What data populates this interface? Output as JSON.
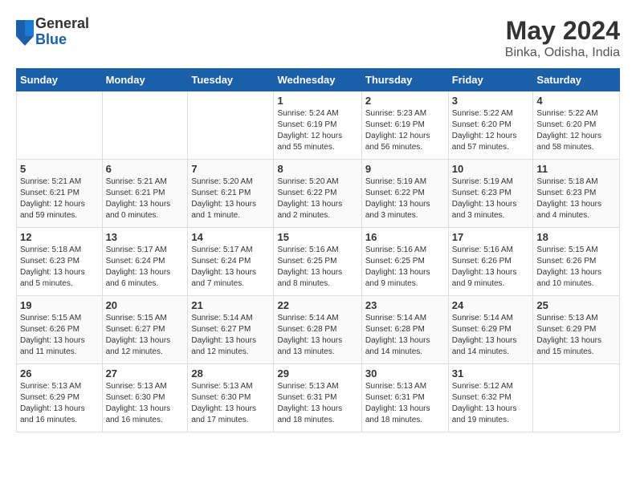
{
  "header": {
    "logo_general": "General",
    "logo_blue": "Blue",
    "title": "May 2024",
    "subtitle": "Binka, Odisha, India"
  },
  "days_of_week": [
    "Sunday",
    "Monday",
    "Tuesday",
    "Wednesday",
    "Thursday",
    "Friday",
    "Saturday"
  ],
  "weeks": [
    [
      {
        "day": "",
        "info": ""
      },
      {
        "day": "",
        "info": ""
      },
      {
        "day": "",
        "info": ""
      },
      {
        "day": "1",
        "info": "Sunrise: 5:24 AM\nSunset: 6:19 PM\nDaylight: 12 hours\nand 55 minutes."
      },
      {
        "day": "2",
        "info": "Sunrise: 5:23 AM\nSunset: 6:19 PM\nDaylight: 12 hours\nand 56 minutes."
      },
      {
        "day": "3",
        "info": "Sunrise: 5:22 AM\nSunset: 6:20 PM\nDaylight: 12 hours\nand 57 minutes."
      },
      {
        "day": "4",
        "info": "Sunrise: 5:22 AM\nSunset: 6:20 PM\nDaylight: 12 hours\nand 58 minutes."
      }
    ],
    [
      {
        "day": "5",
        "info": "Sunrise: 5:21 AM\nSunset: 6:21 PM\nDaylight: 12 hours\nand 59 minutes."
      },
      {
        "day": "6",
        "info": "Sunrise: 5:21 AM\nSunset: 6:21 PM\nDaylight: 13 hours\nand 0 minutes."
      },
      {
        "day": "7",
        "info": "Sunrise: 5:20 AM\nSunset: 6:21 PM\nDaylight: 13 hours\nand 1 minute."
      },
      {
        "day": "8",
        "info": "Sunrise: 5:20 AM\nSunset: 6:22 PM\nDaylight: 13 hours\nand 2 minutes."
      },
      {
        "day": "9",
        "info": "Sunrise: 5:19 AM\nSunset: 6:22 PM\nDaylight: 13 hours\nand 3 minutes."
      },
      {
        "day": "10",
        "info": "Sunrise: 5:19 AM\nSunset: 6:23 PM\nDaylight: 13 hours\nand 3 minutes."
      },
      {
        "day": "11",
        "info": "Sunrise: 5:18 AM\nSunset: 6:23 PM\nDaylight: 13 hours\nand 4 minutes."
      }
    ],
    [
      {
        "day": "12",
        "info": "Sunrise: 5:18 AM\nSunset: 6:23 PM\nDaylight: 13 hours\nand 5 minutes."
      },
      {
        "day": "13",
        "info": "Sunrise: 5:17 AM\nSunset: 6:24 PM\nDaylight: 13 hours\nand 6 minutes."
      },
      {
        "day": "14",
        "info": "Sunrise: 5:17 AM\nSunset: 6:24 PM\nDaylight: 13 hours\nand 7 minutes."
      },
      {
        "day": "15",
        "info": "Sunrise: 5:16 AM\nSunset: 6:25 PM\nDaylight: 13 hours\nand 8 minutes."
      },
      {
        "day": "16",
        "info": "Sunrise: 5:16 AM\nSunset: 6:25 PM\nDaylight: 13 hours\nand 9 minutes."
      },
      {
        "day": "17",
        "info": "Sunrise: 5:16 AM\nSunset: 6:26 PM\nDaylight: 13 hours\nand 9 minutes."
      },
      {
        "day": "18",
        "info": "Sunrise: 5:15 AM\nSunset: 6:26 PM\nDaylight: 13 hours\nand 10 minutes."
      }
    ],
    [
      {
        "day": "19",
        "info": "Sunrise: 5:15 AM\nSunset: 6:26 PM\nDaylight: 13 hours\nand 11 minutes."
      },
      {
        "day": "20",
        "info": "Sunrise: 5:15 AM\nSunset: 6:27 PM\nDaylight: 13 hours\nand 12 minutes."
      },
      {
        "day": "21",
        "info": "Sunrise: 5:14 AM\nSunset: 6:27 PM\nDaylight: 13 hours\nand 12 minutes."
      },
      {
        "day": "22",
        "info": "Sunrise: 5:14 AM\nSunset: 6:28 PM\nDaylight: 13 hours\nand 13 minutes."
      },
      {
        "day": "23",
        "info": "Sunrise: 5:14 AM\nSunset: 6:28 PM\nDaylight: 13 hours\nand 14 minutes."
      },
      {
        "day": "24",
        "info": "Sunrise: 5:14 AM\nSunset: 6:29 PM\nDaylight: 13 hours\nand 14 minutes."
      },
      {
        "day": "25",
        "info": "Sunrise: 5:13 AM\nSunset: 6:29 PM\nDaylight: 13 hours\nand 15 minutes."
      }
    ],
    [
      {
        "day": "26",
        "info": "Sunrise: 5:13 AM\nSunset: 6:29 PM\nDaylight: 13 hours\nand 16 minutes."
      },
      {
        "day": "27",
        "info": "Sunrise: 5:13 AM\nSunset: 6:30 PM\nDaylight: 13 hours\nand 16 minutes."
      },
      {
        "day": "28",
        "info": "Sunrise: 5:13 AM\nSunset: 6:30 PM\nDaylight: 13 hours\nand 17 minutes."
      },
      {
        "day": "29",
        "info": "Sunrise: 5:13 AM\nSunset: 6:31 PM\nDaylight: 13 hours\nand 18 minutes."
      },
      {
        "day": "30",
        "info": "Sunrise: 5:13 AM\nSunset: 6:31 PM\nDaylight: 13 hours\nand 18 minutes."
      },
      {
        "day": "31",
        "info": "Sunrise: 5:12 AM\nSunset: 6:32 PM\nDaylight: 13 hours\nand 19 minutes."
      },
      {
        "day": "",
        "info": ""
      }
    ]
  ]
}
